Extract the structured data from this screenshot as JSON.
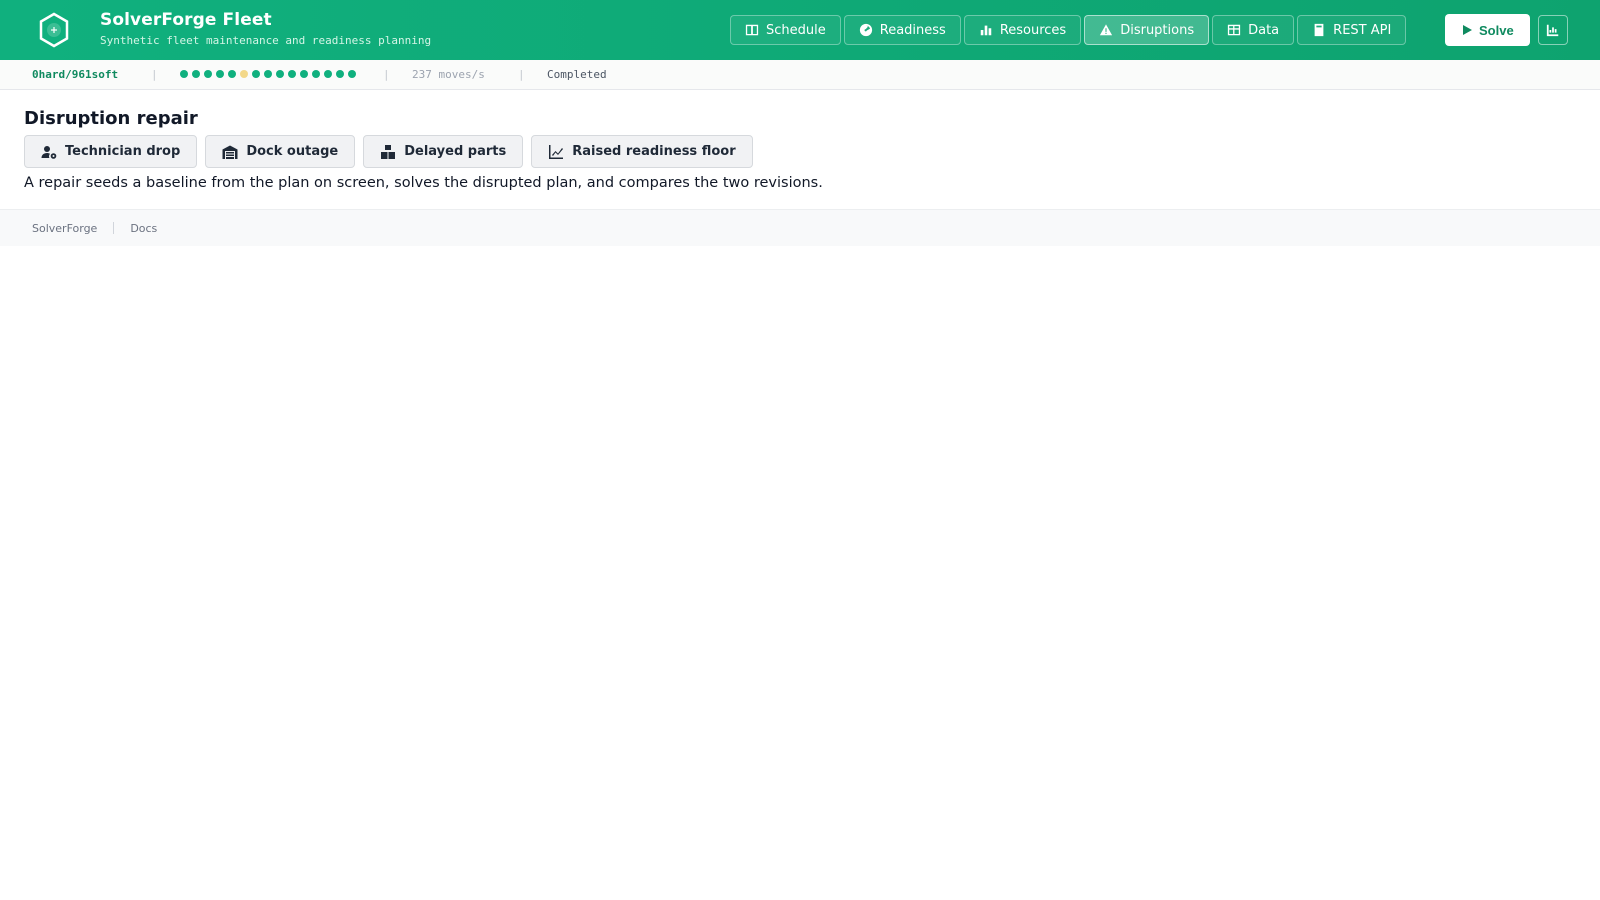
{
  "header": {
    "title": "SolverForge Fleet",
    "subtitle": "Synthetic fleet maintenance and readiness planning",
    "logo_icon": "hexagon-plus-icon",
    "nav": [
      {
        "label": "Schedule",
        "icon": "table-columns-icon",
        "active": false
      },
      {
        "label": "Readiness",
        "icon": "gauge-icon",
        "active": false
      },
      {
        "label": "Resources",
        "icon": "bar-chart-icon",
        "active": false
      },
      {
        "label": "Disruptions",
        "icon": "warning-triangle-icon",
        "active": true
      },
      {
        "label": "Data",
        "icon": "table-icon",
        "active": false
      },
      {
        "label": "REST API",
        "icon": "book-icon",
        "active": false
      }
    ],
    "solve_label": "Solve",
    "analysis_icon": "chart-icon"
  },
  "status": {
    "score": "0hard/961soft",
    "moves": "237 moves/s",
    "state": "Completed",
    "progress_dots": [
      "ok",
      "ok",
      "ok",
      "ok",
      "ok",
      "warn",
      "ok",
      "ok",
      "ok",
      "ok",
      "ok",
      "ok",
      "ok",
      "ok",
      "ok"
    ]
  },
  "main": {
    "title": "Disruption repair",
    "actions": [
      {
        "label": "Technician drop",
        "icon": "user-gear-icon"
      },
      {
        "label": "Dock outage",
        "icon": "warehouse-icon"
      },
      {
        "label": "Delayed parts",
        "icon": "boxes-icon"
      },
      {
        "label": "Raised readiness floor",
        "icon": "line-chart-icon"
      }
    ],
    "description": "A repair seeds a baseline from the plan on screen, solves the disrupted plan, and compares the two revisions."
  },
  "footer": {
    "links": [
      "SolverForge",
      "Docs"
    ]
  },
  "colors": {
    "brand": "#10b07e",
    "warn_dot": "#f3d889"
  }
}
